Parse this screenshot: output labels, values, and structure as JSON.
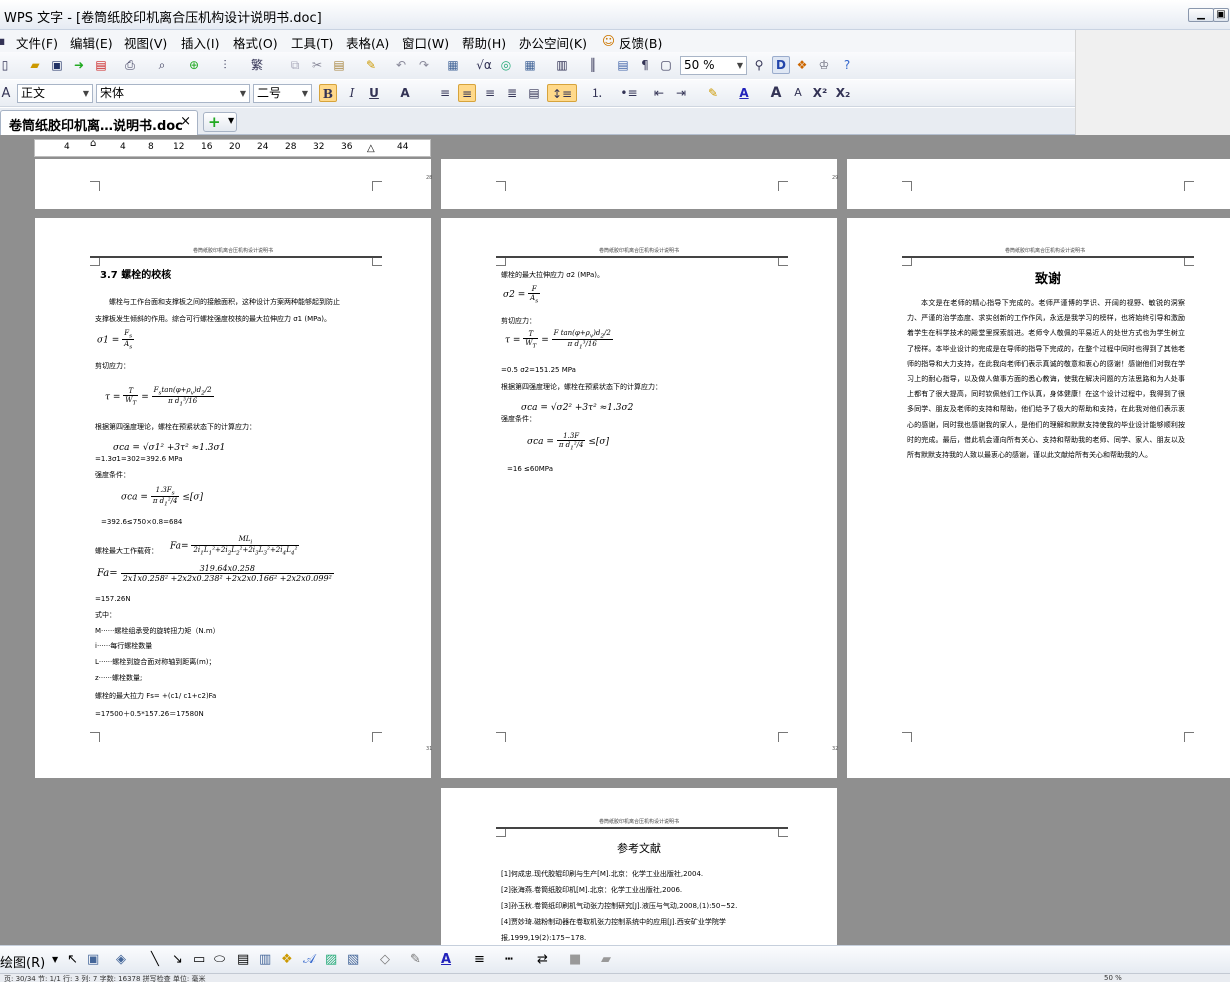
{
  "app": {
    "title": "WPS 文字 - [卷筒纸胶印机离合压机构设计说明书.doc]"
  },
  "menu": [
    "文件(F)",
    "编辑(E)",
    "视图(V)",
    "插入(I)",
    "格式(O)",
    "工具(T)",
    "表格(A)",
    "窗口(W)",
    "帮助(H)",
    "办公空间(K)",
    "反馈(B)"
  ],
  "toolbar": {
    "zoom": "50 %",
    "style": "正文",
    "font": "宋体",
    "size": "二号"
  },
  "tab": {
    "label": "卷筒纸胶印机离…说明书.doc"
  },
  "ruler": {
    "labels": [
      "4",
      "4",
      "8",
      "12",
      "16",
      "20",
      "24",
      "28",
      "32",
      "36",
      "44"
    ]
  },
  "pages": {
    "header_text": "卷筒纸胶印机离合压机构设计说明书",
    "p28": "28",
    "p29": "29",
    "p31": "31",
    "p32": "32",
    "left": {
      "title": "3.7 螺栓的校核",
      "l1": "螺栓与工作台面和支撑板之间的接触面积，这种设计方案两种能够起到防止",
      "l2": "支撑板发生倾斜的作用。综合可行螺栓强度校核的最大拉伸应力 σ1 (MPa)。",
      "shear": "剪切应力：",
      "theory": "根据第四强度理论，螺栓在预紧状态下的计算应力：",
      "calc1": "=1.3σ1=302=392.6 MPa",
      "cond": "强度条件：",
      "calc2": "=392.6≤750×0.8=684",
      "maxload": "螺栓最大工作载荷：",
      "calc3": "=157.26N",
      "where": "式中：",
      "w1": "M······螺栓组承受的旋转扭力矩（N.m）",
      "w2": "i······每行螺栓数量",
      "w3": "L······螺栓到旋合面对称轴到距离(m)；",
      "w4": "z······螺栓数量;",
      "force": "螺栓的最大拉力 Fs=  +(c1/ c1+c2)Fa",
      "force2": "=17500＋0.5*157.26＝17580N"
    },
    "middle": {
      "l1": "螺栓的最大拉伸应力 σ2 (MPa)。",
      "shear": "剪切应力：",
      "calc1": "=0.5 σ2=151.25 MPa",
      "theory": "根据第四强度理论，螺栓在预紧状态下的计算应力：",
      "eq": "σca = √σ2² +3τ² ≈1.3σ2",
      "cond": "强度条件：",
      "calc2": "=16 ≤60MPa"
    },
    "right": {
      "title": "致谢",
      "body": "本文是在老师的精心指导下完成的。老师严谨博的学识、开阔的视野、敏锐的洞察力、严谨的治学态度、求实创新的工作作风，永远是我学习的榜样，也将始终引导和激励着学生在科学技术的殿堂里探索前进。老师令人敬佩的平易近人的处世方式也为学生树立了榜样。本毕业设计的完成是在导师的指导下完成的，在整个过程中同时也得到了其他老师的指导和大力支持，在此我向老师们表示真诚的敬意和衷心的感谢！感谢他们对我在学习上的耐心指导，以及做人做事方面的悉心教诲，使我在解决问题的方法思路和为人处事上都有了很大提高，同时钦佩他们工作认真，身体健康！在这个设计过程中，我得到了很多同学、朋友及老师的支持和帮助，他们给予了极大的帮助和支持，在此我对他们表示衷心的感谢，同时我也感谢我的家人，是他们的理解和默默支持使我的毕业设计能够顺利按时的完成。最后，借此机会谨向所有关心、支持和帮助我的老师、同学、家人、朋友以及所有默默支持我的人致以最衷心的感谢，谨以此文献给所有关心和帮助我的人。"
    },
    "refs": {
      "title": "参考文献",
      "r1": "[1]何成忠.现代胶辊印刷与生产[M].北京：化学工业出版社,2004.",
      "r2": "[2]张海燕.卷筒纸胶印机[M].北京：化学工业出版社,2006.",
      "r3": "[3]孙玉秋.卷筒纸印刷机气动张力控制研究[J].液压与气动,2008,(1):50~52.",
      "r4": "[4]贾妙琦.磁粉制动器在卷取机张力控制系统中的应用[J].西安矿业学院学",
      "r5": "报,1999,19(2):175~178."
    }
  },
  "drawbar": {
    "label": "绘图(R)"
  },
  "status": {
    "text": "页: 30/34  节: 1/1  行: 3  列: 7  字数: 16378  拼写检查  单位: 毫米",
    "zoom": "50 %"
  }
}
